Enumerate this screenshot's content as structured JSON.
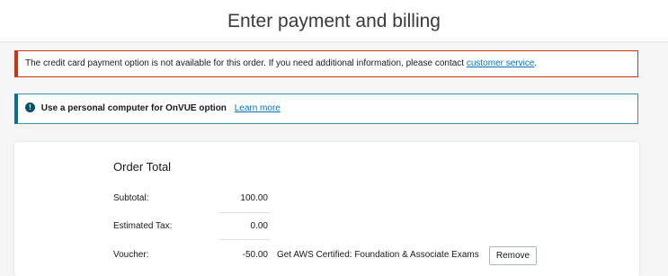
{
  "header": {
    "title": "Enter payment and billing"
  },
  "alerts": {
    "error": {
      "message": "The credit card payment option is not available for this order. If you need additional information, please contact ",
      "link_label": "customer service",
      "suffix": ".",
      "color": "#d13212"
    },
    "info": {
      "icon": "info-circle-icon",
      "message": "Use a personal computer for OnVUE option",
      "link_label": "Learn more",
      "color": "#0b6f8f"
    }
  },
  "order": {
    "title": "Order Total",
    "rows": [
      {
        "label": "Subtotal:",
        "value": "100.00"
      },
      {
        "label": "Estimated Tax:",
        "value": "0.00"
      },
      {
        "label": "Voucher:",
        "value": "-50.00",
        "description": "Get AWS Certified: Foundation & Associate Exams",
        "action_label": "Remove"
      }
    ]
  }
}
